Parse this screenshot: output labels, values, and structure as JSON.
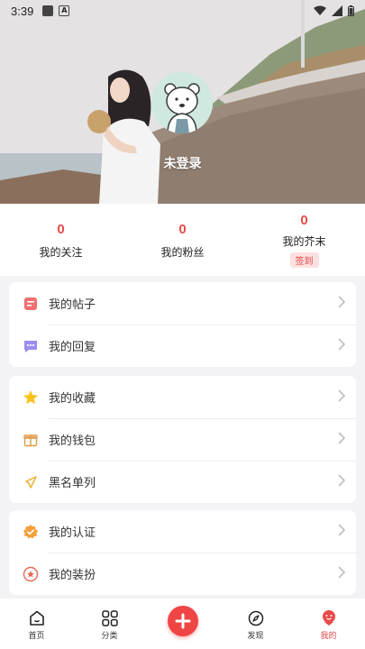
{
  "status_bar": {
    "time": "3:39"
  },
  "profile": {
    "login_status": "未登录"
  },
  "stats": [
    {
      "count": "0",
      "label": "我的关注"
    },
    {
      "count": "0",
      "label": "我的粉丝"
    },
    {
      "count": "0",
      "label": "我的芥末",
      "badge": "签到"
    }
  ],
  "menu": {
    "group1": [
      {
        "label": "我的帖子"
      },
      {
        "label": "我的回复"
      }
    ],
    "group2": [
      {
        "label": "我的收藏"
      },
      {
        "label": "我的钱包"
      },
      {
        "label": "黑名单列"
      }
    ],
    "group3": [
      {
        "label": "我的认证"
      },
      {
        "label": "我的装扮"
      }
    ]
  },
  "bottom_nav": {
    "home": "首页",
    "category": "分类",
    "discover": "发现",
    "mine": "我的"
  },
  "colors": {
    "accent": "#e84a4a",
    "card_bg": "#ffffff",
    "page_bg": "#f3f3f5"
  }
}
